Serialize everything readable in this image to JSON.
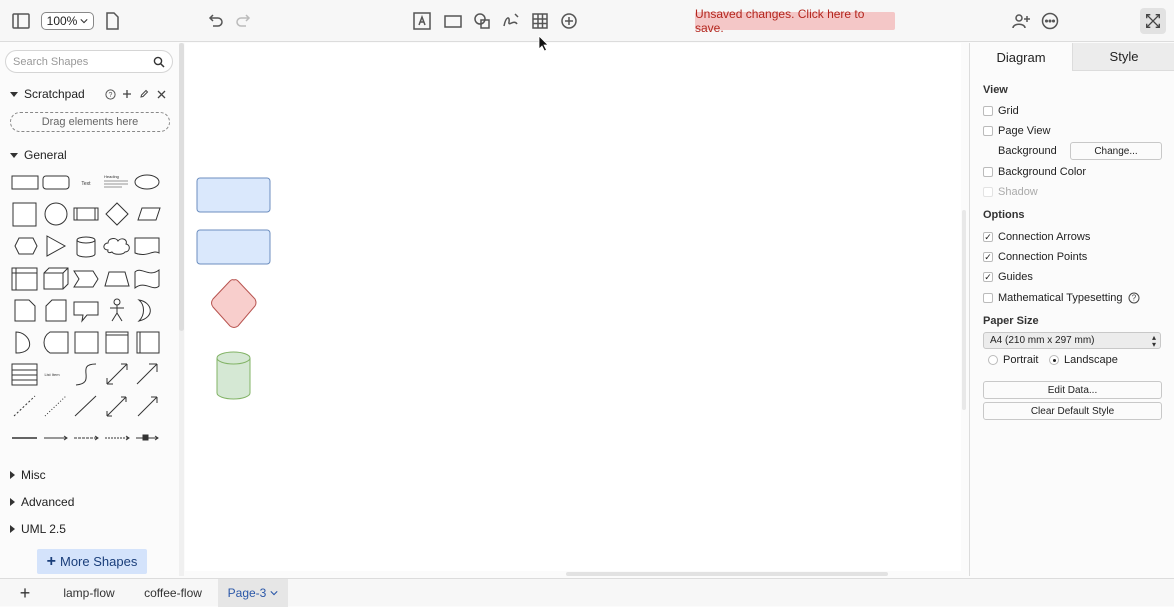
{
  "toolbar": {
    "zoom": "100%",
    "unsaved_message": "Unsaved changes. Click here to save.",
    "icons": [
      "format-panel-icon",
      "page-icon",
      "undo-icon",
      "redo-icon",
      "text-icon",
      "rectangle-icon",
      "shapes-icon",
      "freehand-icon",
      "table-icon",
      "insert-icon",
      "share-icon",
      "more-icon",
      "fullscreen-icon"
    ]
  },
  "left_panel": {
    "search_placeholder": "Search Shapes",
    "scratchpad": {
      "label": "Scratchpad",
      "drag_hint": "Drag elements here"
    },
    "general": {
      "label": "General"
    },
    "sections": [
      "Misc",
      "Advanced",
      "UML 2.5"
    ],
    "shape_labels": {
      "text": "Text",
      "heading": "Heading",
      "list": "List Item"
    },
    "more_shapes": "More Shapes"
  },
  "right_panel": {
    "tabs": [
      "Diagram",
      "Style"
    ],
    "view_label": "View",
    "view_items": [
      {
        "label": "Grid",
        "checked": false
      },
      {
        "label": "Page View",
        "checked": false
      },
      {
        "label": "Background",
        "button": "Change..."
      },
      {
        "label": "Background Color",
        "checked": false
      },
      {
        "label": "Shadow",
        "checked": false,
        "disabled": true
      }
    ],
    "options_label": "Options",
    "options_items": [
      {
        "label": "Connection Arrows",
        "checked": true
      },
      {
        "label": "Connection Points",
        "checked": true
      },
      {
        "label": "Guides",
        "checked": true
      },
      {
        "label": "Mathematical Typesetting",
        "checked": false
      }
    ],
    "paper_size_label": "Paper Size",
    "paper_size_value": "A4 (210 mm x 297 mm)",
    "orientation": {
      "portrait": "Portrait",
      "landscape": "Landscape",
      "selected": "Landscape"
    },
    "edit_data_button": "Edit Data...",
    "clear_style_button": "Clear Default Style"
  },
  "bottom_bar": {
    "add_page": "+",
    "pages": [
      "lamp-flow",
      "coffee-flow",
      "Page-3"
    ],
    "active_page": "Page-3"
  },
  "colors": {
    "unsaved_bg": "#f4c7c7",
    "unsaved_text": "#b3261e",
    "blue_fill": "#dae8fc",
    "blue_stroke": "#6c8ebf",
    "red_fill": "#f8cecc",
    "red_stroke": "#b85450",
    "green_fill": "#d5e8d4",
    "green_stroke": "#82b366",
    "more_shapes_bg": "#d4e3fb"
  }
}
